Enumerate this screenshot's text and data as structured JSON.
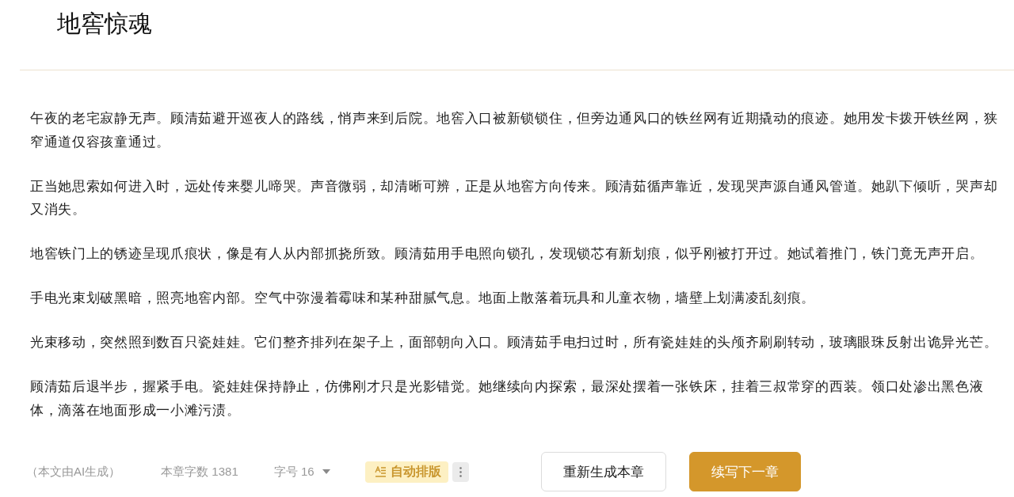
{
  "title": "地窖惊魂",
  "paragraphs": [
    "午夜的老宅寂静无声。顾清茹避开巡夜人的路线，悄声来到后院。地窖入口被新锁锁住，但旁边通风口的铁丝网有近期撬动的痕迹。她用发卡拨开铁丝网，狭窄通道仅容孩童通过。",
    "正当她思索如何进入时，远处传来婴儿啼哭。声音微弱，却清晰可辨，正是从地窖方向传来。顾清茹循声靠近，发现哭声源自通风管道。她趴下倾听，哭声却又消失。",
    "地窖铁门上的锈迹呈现爪痕状，像是有人从内部抓挠所致。顾清茹用手电照向锁孔，发现锁芯有新划痕，似乎刚被打开过。她试着推门，铁门竟无声开启。",
    "手电光束划破黑暗，照亮地窖内部。空气中弥漫着霉味和某种甜腻气息。地面上散落着玩具和儿童衣物，墙壁上划满凌乱刻痕。",
    "光束移动，突然照到数百只瓷娃娃。它们整齐排列在架子上，面部朝向入口。顾清茹手电扫过时，所有瓷娃娃的头颅齐刷刷转动，玻璃眼珠反射出诡异光芒。",
    "顾清茹后退半步，握紧手电。瓷娃娃保持静止，仿佛刚才只是光影错觉。她继续向内探索，最深处摆着一张铁床，挂着三叔常穿的西装。领口处渗出黑色液体，滴落在地面形成一小滩污渍。"
  ],
  "footer": {
    "ai_note": "（本文由AI生成）",
    "word_count": "本章字数 1381",
    "font_size": "字号 16",
    "auto_layout": "自动排版"
  },
  "buttons": [
    {
      "label": "重新生成本章",
      "kind": "secondary"
    },
    {
      "label": "续写下一章",
      "kind": "primary"
    }
  ]
}
